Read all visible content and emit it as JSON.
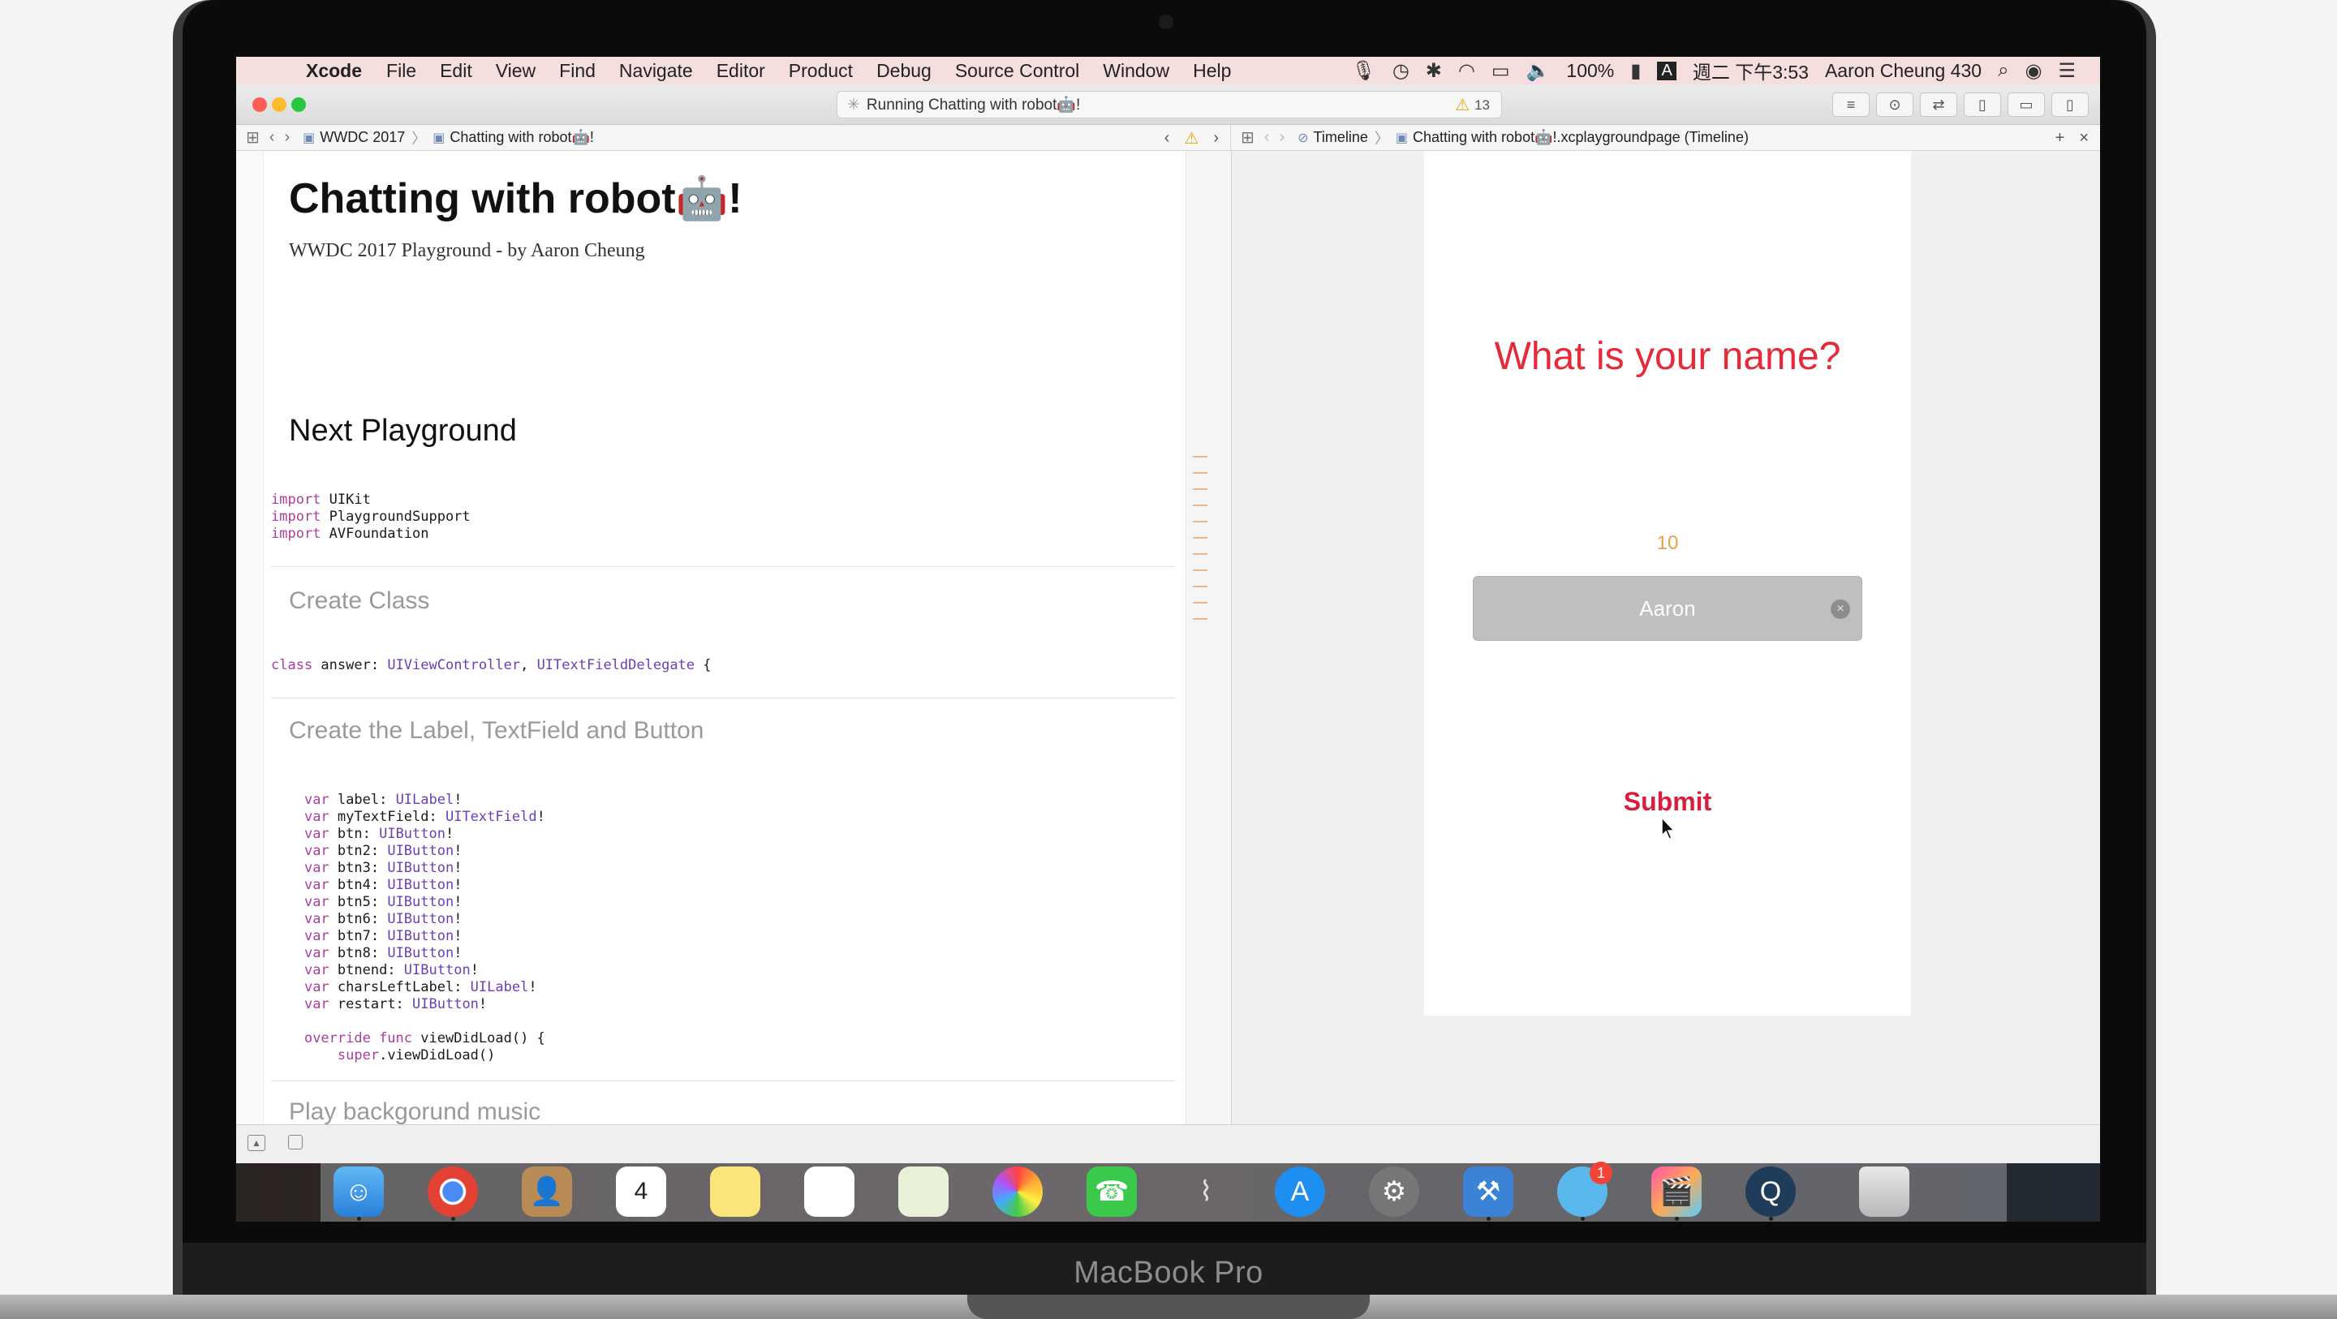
{
  "device": {
    "label": "MacBook Pro"
  },
  "menubar": {
    "app": "Xcode",
    "items": [
      "File",
      "Edit",
      "View",
      "Find",
      "Navigate",
      "Editor",
      "Product",
      "Debug",
      "Source Control",
      "Window",
      "Help"
    ],
    "battery": "100%",
    "input_method": "A",
    "clock": "週二 下午3:53",
    "user": "Aaron Cheung 430"
  },
  "window": {
    "status_text": "Running Chatting with robot🤖!",
    "warning_count": "13"
  },
  "jumpbar_left": {
    "crumb1": "WWDC 2017",
    "crumb2": "Chatting with robot🤖!"
  },
  "jumpbar_right": {
    "crumb1": "Timeline",
    "crumb2": "Chatting with robot🤖!.xcplaygroundpage (Timeline)"
  },
  "editor": {
    "title": "Chatting with robot🤖!",
    "subtitle": "WWDC 2017 Playground - by Aaron Cheung",
    "next_heading": "Next Playground",
    "section_create_class": "Create Class",
    "section_create_label": "Create the Label, TextField and Button",
    "section_music": "Play backgorund music"
  },
  "liveview": {
    "question": "What is your name?",
    "chars_left": "10",
    "text_value": "Aaron",
    "submit_label": "Submit"
  },
  "colors": {
    "accent_red": "#e52a3a",
    "chars_orange": "#e5a24a",
    "keyword": "#a93ea0",
    "type": "#6a3fb5"
  }
}
